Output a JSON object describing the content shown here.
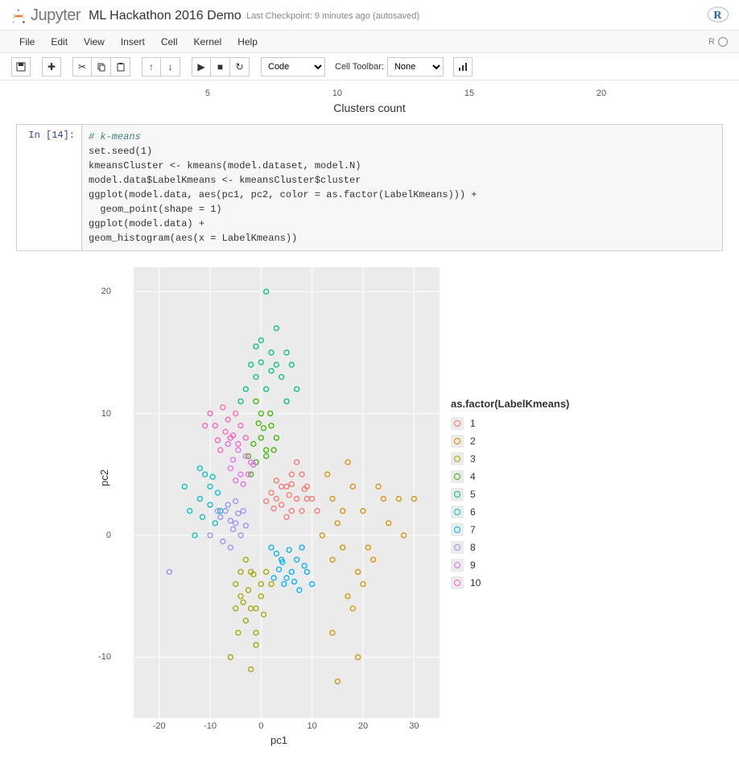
{
  "header": {
    "brand": "Jupyter",
    "notebook_name": "ML Hackathon 2016 Demo",
    "checkpoint": "Last Checkpoint: 9 minutes ago (autosaved)"
  },
  "menubar": {
    "items": [
      "File",
      "Edit",
      "View",
      "Insert",
      "Cell",
      "Kernel",
      "Help"
    ],
    "kernel_name": "R"
  },
  "toolbar": {
    "cell_type": "Code",
    "cell_toolbar_label": "Cell Toolbar:",
    "cell_toolbar_value": "None"
  },
  "prev_output": {
    "ticks": [
      "5",
      "10",
      "15",
      "20"
    ],
    "xlabel": "Clusters count"
  },
  "cell": {
    "prompt": "In [14]:",
    "code_lines": [
      {
        "t": "comment",
        "text": "# k-means"
      },
      {
        "text": "set.seed(1)"
      },
      {
        "text": "kmeansCluster <- kmeans(model.dataset, model.N)"
      },
      {
        "text": "model.data$LabelKmeans <- kmeansCluster$cluster"
      },
      {
        "text": ""
      },
      {
        "text": "ggplot(model.data, aes(pc1, pc2, color = as.factor(LabelKmeans))) +"
      },
      {
        "text": "  geom_point(shape = 1)"
      },
      {
        "text": "ggplot(model.data) +"
      },
      {
        "text": "geom_histogram(aes(x = LabelKmeans))"
      }
    ]
  },
  "chart_data": {
    "type": "scatter",
    "title": "",
    "xlabel": "pc1",
    "ylabel": "pc2",
    "xlim": [
      -25,
      35
    ],
    "ylim": [
      -15,
      22
    ],
    "x_ticks": [
      -20,
      -10,
      0,
      10,
      20,
      30
    ],
    "y_ticks": [
      -10,
      0,
      10,
      20
    ],
    "legend_title": "as.factor(LabelKmeans)",
    "legend_labels": [
      "1",
      "2",
      "3",
      "4",
      "5",
      "6",
      "7",
      "8",
      "9",
      "10"
    ],
    "colors": [
      "#F8766D",
      "#D89000",
      "#A3A500",
      "#39B600",
      "#00BF7D",
      "#00BFC4",
      "#00B0F6",
      "#9590FF",
      "#E76BF3",
      "#FF62BC"
    ],
    "series": [
      {
        "name": "1",
        "points": [
          [
            3,
            3
          ],
          [
            5,
            4
          ],
          [
            7,
            3
          ],
          [
            6,
            5
          ],
          [
            8,
            2
          ],
          [
            4,
            2.5
          ],
          [
            9,
            4
          ],
          [
            2,
            3.5
          ],
          [
            6,
            2
          ],
          [
            10,
            3
          ],
          [
            5,
            1.5
          ],
          [
            8,
            5
          ],
          [
            3,
            4.5
          ],
          [
            11,
            2
          ],
          [
            7,
            6
          ],
          [
            4,
            4
          ],
          [
            9,
            3
          ],
          [
            6,
            4.2
          ],
          [
            2.5,
            2.2
          ],
          [
            8.5,
            3.8
          ],
          [
            1,
            2.8
          ],
          [
            5.5,
            3.3
          ]
        ]
      },
      {
        "name": "2",
        "points": [
          [
            14,
            3
          ],
          [
            16,
            -1
          ],
          [
            18,
            4
          ],
          [
            20,
            2
          ],
          [
            22,
            -2
          ],
          [
            24,
            3
          ],
          [
            17,
            6
          ],
          [
            19,
            -3
          ],
          [
            25,
            1
          ],
          [
            27,
            3
          ],
          [
            15,
            1
          ],
          [
            21,
            -1
          ],
          [
            23,
            4
          ],
          [
            17,
            -5
          ],
          [
            28,
            0
          ],
          [
            16,
            2
          ],
          [
            13,
            5
          ],
          [
            14,
            -2
          ],
          [
            20,
            -4
          ],
          [
            30,
            3
          ],
          [
            12,
            0
          ],
          [
            18,
            -6
          ],
          [
            15,
            -12
          ],
          [
            19,
            -10
          ],
          [
            14,
            -8
          ]
        ]
      },
      {
        "name": "3",
        "points": [
          [
            -2,
            -3
          ],
          [
            -4,
            -5
          ],
          [
            -1,
            -6
          ],
          [
            0,
            -4
          ],
          [
            -3,
            -2
          ],
          [
            -5,
            -4
          ],
          [
            -1,
            -8
          ],
          [
            1,
            -3
          ],
          [
            -2,
            -6
          ],
          [
            -4,
            -3
          ],
          [
            0,
            -5
          ],
          [
            -3,
            -7
          ],
          [
            -1,
            -9
          ],
          [
            2,
            -4
          ],
          [
            -5,
            -6
          ],
          [
            -2.5,
            -4.5
          ],
          [
            -1.5,
            -3.2
          ],
          [
            0.5,
            -6.5
          ],
          [
            -3.5,
            -5.5
          ],
          [
            -4.5,
            -8
          ],
          [
            -6,
            -10
          ],
          [
            -2,
            -11
          ]
        ]
      },
      {
        "name": "4",
        "points": [
          [
            -1,
            6
          ],
          [
            0,
            8
          ],
          [
            1,
            7
          ],
          [
            -2,
            5
          ],
          [
            2,
            9
          ],
          [
            0,
            10
          ],
          [
            -1,
            11
          ],
          [
            3,
            8
          ],
          [
            1,
            6.5
          ],
          [
            -1.5,
            7.5
          ],
          [
            2.5,
            7
          ],
          [
            0.5,
            8.8
          ],
          [
            -2.5,
            6.5
          ],
          [
            1.8,
            10
          ],
          [
            -0.5,
            9.2
          ]
        ]
      },
      {
        "name": "5",
        "points": [
          [
            1,
            12
          ],
          [
            3,
            14
          ],
          [
            -1,
            13
          ],
          [
            5,
            11
          ],
          [
            2,
            15
          ],
          [
            -3,
            12
          ],
          [
            4,
            13
          ],
          [
            0,
            16
          ],
          [
            6,
            14
          ],
          [
            -2,
            14
          ],
          [
            3,
            17
          ],
          [
            1,
            20
          ],
          [
            -4,
            11
          ],
          [
            7,
            12
          ],
          [
            2,
            13.5
          ],
          [
            -1,
            15.5
          ],
          [
            5,
            15
          ],
          [
            0,
            14.2
          ]
        ]
      },
      {
        "name": "6",
        "points": [
          [
            -8,
            2
          ],
          [
            -10,
            4
          ],
          [
            -12,
            3
          ],
          [
            -9,
            1
          ],
          [
            -11,
            5
          ],
          [
            -14,
            2
          ],
          [
            -13,
            0
          ],
          [
            -15,
            4
          ],
          [
            -10,
            2.5
          ],
          [
            -12,
            5.5
          ],
          [
            -8.5,
            3.5
          ],
          [
            -11.5,
            1.5
          ],
          [
            -9.5,
            4.8
          ]
        ]
      },
      {
        "name": "7",
        "points": [
          [
            2,
            -1
          ],
          [
            4,
            -2
          ],
          [
            6,
            -3
          ],
          [
            3,
            -1.5
          ],
          [
            5,
            -3.5
          ],
          [
            7,
            -2
          ],
          [
            4.5,
            -4
          ],
          [
            8,
            -1
          ],
          [
            6.5,
            -3.8
          ],
          [
            3.5,
            -2.8
          ],
          [
            9,
            -3
          ],
          [
            5.5,
            -1.2
          ],
          [
            2.5,
            -3.5
          ],
          [
            7.5,
            -4.5
          ],
          [
            4.2,
            -2.2
          ],
          [
            10,
            -4
          ],
          [
            8.5,
            -2.5
          ]
        ]
      },
      {
        "name": "8",
        "points": [
          [
            -5,
            1
          ],
          [
            -7,
            2
          ],
          [
            -4,
            0
          ],
          [
            -6,
            -1
          ],
          [
            -8,
            1.5
          ],
          [
            -3.5,
            2
          ],
          [
            -5.5,
            0.5
          ],
          [
            -7.5,
            -0.5
          ],
          [
            -4.5,
            1.8
          ],
          [
            -6.5,
            2.5
          ],
          [
            -3,
            0.8
          ],
          [
            -8.5,
            2
          ],
          [
            -5,
            2.8
          ],
          [
            -6,
            1.2
          ],
          [
            -10,
            0
          ],
          [
            -18,
            -3
          ]
        ]
      },
      {
        "name": "9",
        "points": [
          [
            -4,
            5
          ],
          [
            -2,
            6
          ],
          [
            -5,
            4.5
          ],
          [
            -3,
            6.5
          ],
          [
            -6,
            5.5
          ],
          [
            -4.5,
            7
          ],
          [
            -2.5,
            5
          ],
          [
            -5.5,
            6.2
          ],
          [
            -3.5,
            4.2
          ],
          [
            -6.5,
            7.5
          ],
          [
            -1.5,
            5.8
          ]
        ]
      },
      {
        "name": "10",
        "points": [
          [
            -6,
            8
          ],
          [
            -4,
            9
          ],
          [
            -8,
            7
          ],
          [
            -5,
            10
          ],
          [
            -7,
            8.5
          ],
          [
            -3,
            8
          ],
          [
            -9,
            9
          ],
          [
            -6.5,
            9.5
          ],
          [
            -4.5,
            7.5
          ],
          [
            -10,
            10
          ],
          [
            -5.5,
            8.2
          ],
          [
            -8.5,
            7.8
          ],
          [
            -11,
            9
          ],
          [
            -7.5,
            10.5
          ]
        ]
      }
    ]
  }
}
